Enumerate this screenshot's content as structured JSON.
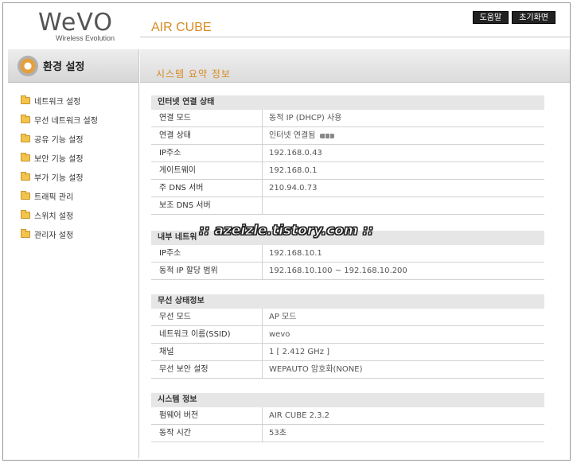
{
  "header": {
    "logo": "WeVO",
    "logo_sub": "Wireless Evolution",
    "product": "AIR CUBE",
    "buttons": [
      "도움말",
      "초기화면"
    ]
  },
  "sidebar": {
    "title": "환경 설정",
    "items": [
      {
        "label": "네트워크 설정"
      },
      {
        "label": "무선 네트워크 설정"
      },
      {
        "label": "공유 기능 설정"
      },
      {
        "label": "보안 기능 설정"
      },
      {
        "label": "부가 기능 설정"
      },
      {
        "label": "트래픽 관리"
      },
      {
        "label": "스위치 설정"
      },
      {
        "label": "관리자 설정"
      }
    ]
  },
  "main": {
    "title": "시스템 요약 정보",
    "sections": [
      {
        "title": "인터넷 연결 상태",
        "rows": [
          {
            "k": "연결 모드",
            "v": "동적 IP (DHCP) 사용"
          },
          {
            "k": "연결 상태",
            "v": "인터넷 연결됨"
          },
          {
            "k": "IP주소",
            "v": "192.168.0.43"
          },
          {
            "k": "게이트웨이",
            "v": "192.168.0.1"
          },
          {
            "k": "주 DNS 서버",
            "v": "210.94.0.73"
          },
          {
            "k": "보조 DNS 서버",
            "v": ""
          }
        ]
      },
      {
        "title": "내부 네트워",
        "rows": [
          {
            "k": "IP주소",
            "v": "192.168.10.1"
          },
          {
            "k": "동적 IP 할당 범위",
            "v": "192.168.10.100 ~ 192.168.10.200"
          }
        ]
      },
      {
        "title": "무선 상태정보",
        "rows": [
          {
            "k": "무선 모드",
            "v": "AP 모드"
          },
          {
            "k": "네트워크 이름(SSID)",
            "v": "wevo"
          },
          {
            "k": "채널",
            "v": "1 [ 2.412 GHz ]"
          },
          {
            "k": "무선 보안 설정",
            "v": "WEPAUTO 암호화(NONE)"
          }
        ]
      },
      {
        "title": "시스템 정보",
        "rows": [
          {
            "k": "펌웨어 버전",
            "v": "AIR CUBE 2.3.2"
          },
          {
            "k": "동작 시간",
            "v": "53초"
          }
        ]
      }
    ]
  },
  "watermark": ":: azeizle.tistory.com ::"
}
